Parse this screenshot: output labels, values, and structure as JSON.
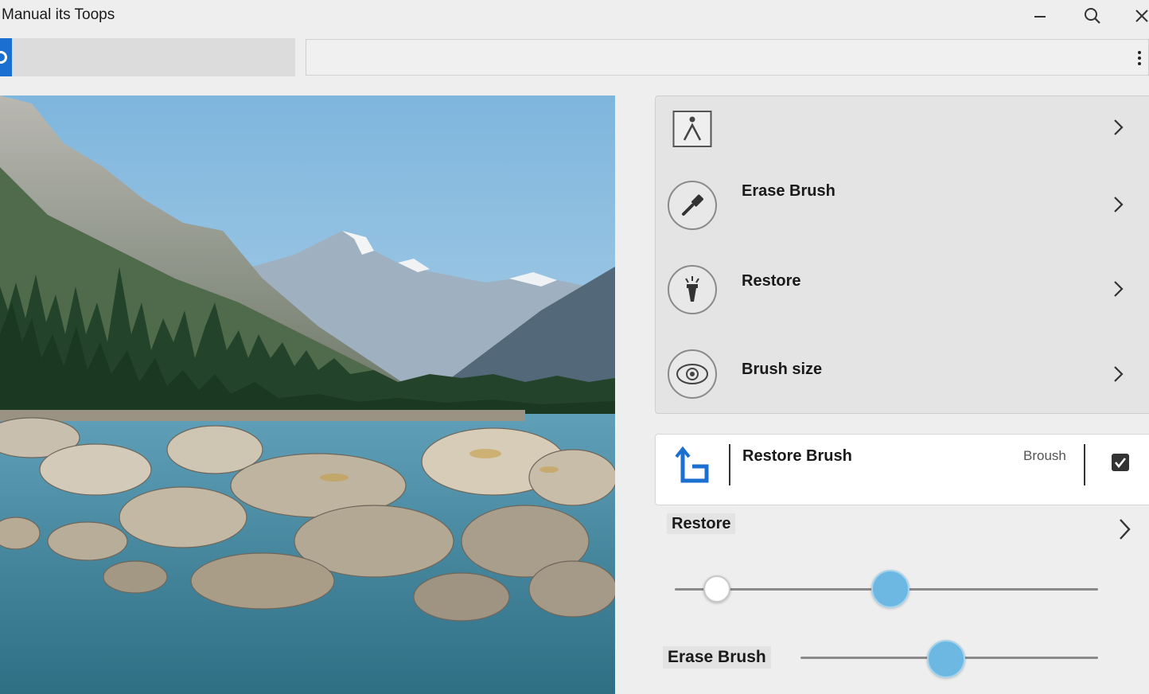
{
  "window": {
    "title": "Manual its Toops",
    "controls": [
      "minimize-icon",
      "search-icon",
      "close-icon"
    ]
  },
  "toolbar": {
    "search_value": "",
    "menu_icon": "kebab-menu-icon"
  },
  "tools": [
    {
      "name": "image-tool",
      "label": "",
      "icon": "person-frame-icon"
    },
    {
      "name": "erase-brush",
      "label": "Erase Brush",
      "icon": "brush-icon"
    },
    {
      "name": "restore",
      "label": "Restore",
      "icon": "torch-icon"
    },
    {
      "name": "brush-size",
      "label": "Brush size",
      "icon": "eye-icon"
    }
  ],
  "restore_brush_card": {
    "title": "Restore Brush",
    "tag": "Broush",
    "checked": true,
    "icon": "restore-arrow-icon"
  },
  "restore_section": {
    "label": "Restore",
    "slider_low": 0.1,
    "slider_high": 0.51
  },
  "erase_section": {
    "label": "Erase Brush",
    "slider_value": 0.49
  },
  "colors": {
    "accent_blue": "#1a6fd0",
    "slider_blue": "#6cb8e2"
  }
}
